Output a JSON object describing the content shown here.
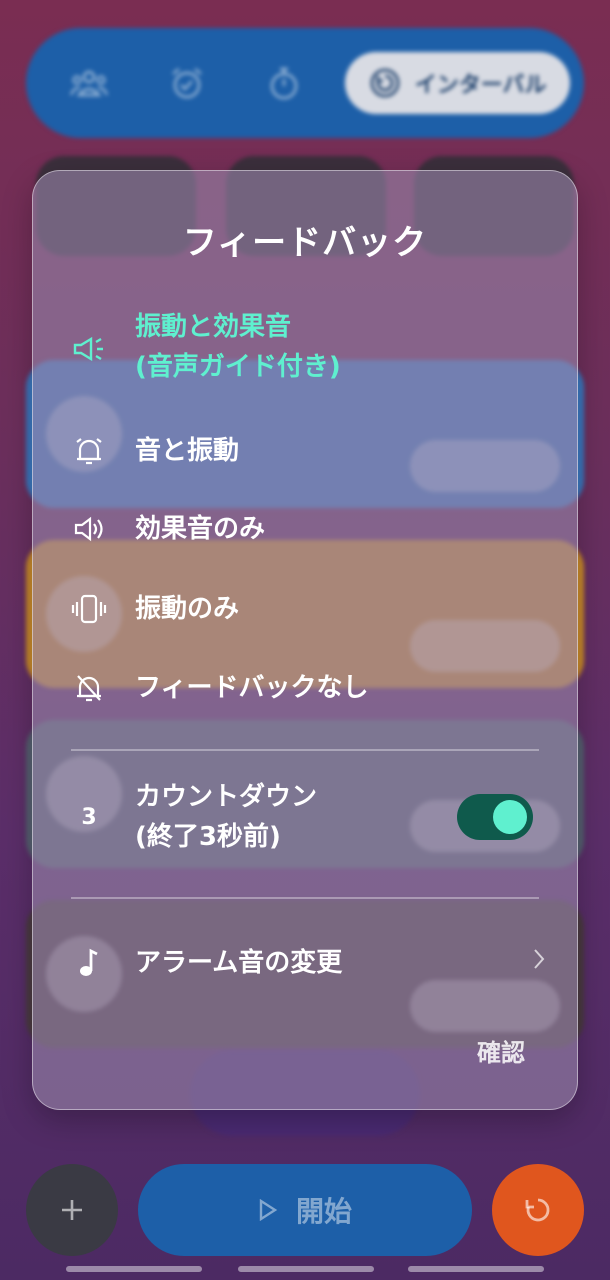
{
  "tabs": {
    "items": [
      {
        "name": "group-icon"
      },
      {
        "name": "alarm-icon"
      },
      {
        "name": "stopwatch-icon"
      }
    ],
    "active_label": "インターバル",
    "active_icon": "interval-timer-icon"
  },
  "dialog": {
    "title": "フィードバック",
    "options": [
      {
        "icon": "megaphone-icon",
        "line1": "振動と効果音",
        "line2": "(音声ガイド付き)",
        "selected": true
      },
      {
        "icon": "bell-icon",
        "line1": "音と振動",
        "selected": false
      },
      {
        "icon": "speaker-icon",
        "line1": "効果音のみ",
        "selected": false
      },
      {
        "icon": "vibration-icon",
        "line1": "振動のみ",
        "selected": false
      },
      {
        "icon": "bell-off-icon",
        "line1": "フィードバックなし",
        "selected": false
      }
    ],
    "countdown": {
      "icon_text": "3",
      "line1": "カウントダウン",
      "line2": "(終了3秒前)",
      "enabled": true
    },
    "alarm_sound": {
      "icon": "music-note-icon",
      "label": "アラーム音の変更"
    },
    "confirm_label": "確認"
  },
  "bottom_bar": {
    "add_icon": "plus-icon",
    "start_label": "開始",
    "start_icon": "play-icon",
    "reset_icon": "reset-icon"
  },
  "colors": {
    "accent": "#5ff0cf",
    "toggle_track": "#0f5a4c",
    "primary_blue": "#1d5fa8",
    "reset_orange": "#e0561e"
  }
}
